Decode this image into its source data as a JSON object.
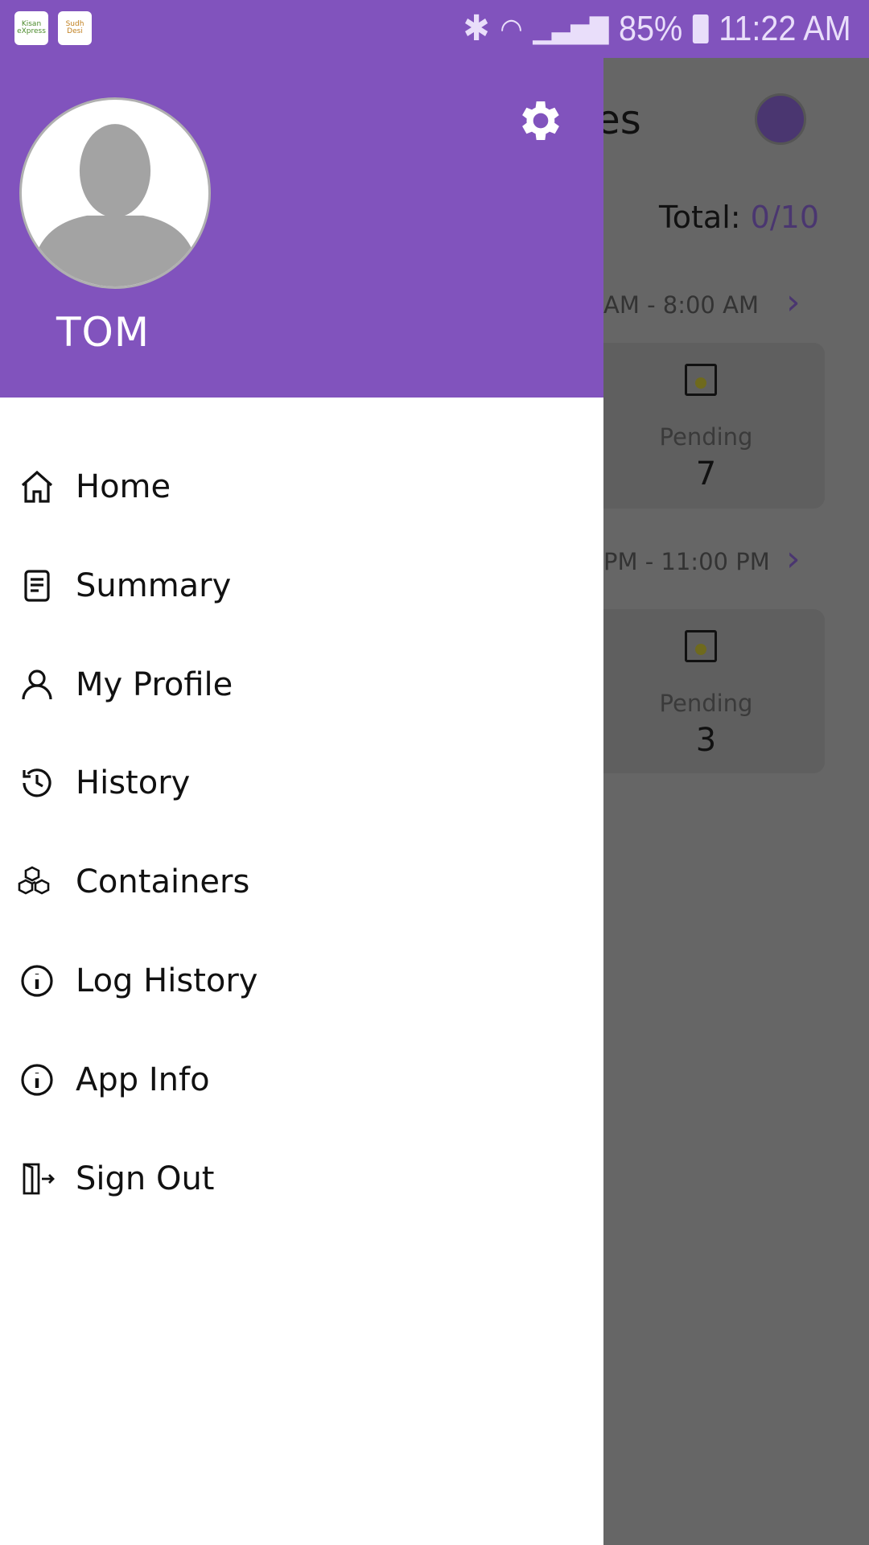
{
  "status_bar": {
    "battery": "85%",
    "time": "11:22 AM",
    "app_icons": [
      "Kisan eXpress",
      "Sudh Desi"
    ]
  },
  "drawer": {
    "user_name": "TOM",
    "menu": [
      {
        "label": "Home",
        "icon": "home-icon"
      },
      {
        "label": "Summary",
        "icon": "document-icon"
      },
      {
        "label": "My Profile",
        "icon": "person-icon"
      },
      {
        "label": "History",
        "icon": "history-icon"
      },
      {
        "label": "Containers",
        "icon": "boxes-icon"
      },
      {
        "label": "Log History",
        "icon": "info-icon"
      },
      {
        "label": "App Info",
        "icon": "info-icon"
      },
      {
        "label": "Sign Out",
        "icon": "sign-out-icon"
      }
    ]
  },
  "background": {
    "title_partial": "es",
    "total_label": "Total:",
    "total_value": "0/10",
    "slots": [
      {
        "time": "AM - 8:00 AM",
        "status": "Pending",
        "count": "7"
      },
      {
        "time": "PM - 11:00 PM",
        "status": "Pending",
        "count": "3"
      }
    ]
  },
  "colors": {
    "accent": "#8153bd",
    "overlay": "#666666"
  }
}
